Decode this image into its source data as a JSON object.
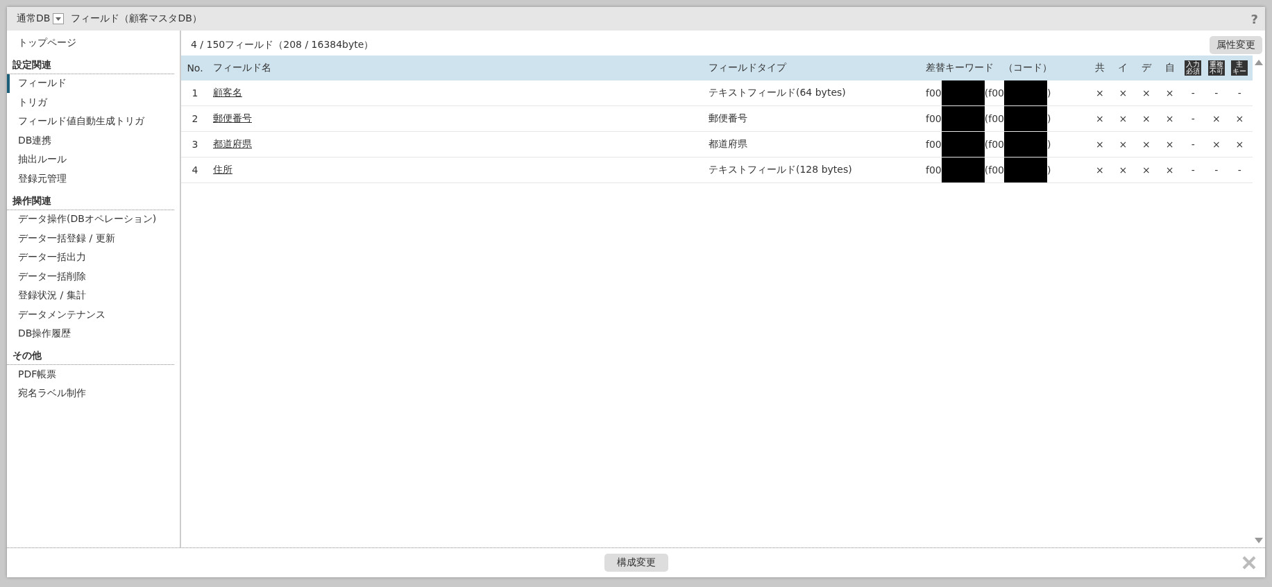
{
  "header": {
    "db_menu": "通常DB",
    "title": "フィールド（顧客マスタDB）",
    "help": "?"
  },
  "sidebar": {
    "top": {
      "label": "トップページ",
      "selected": false
    },
    "sections": [
      {
        "title": "設定関連",
        "items": [
          {
            "label": "フィールド",
            "selected": true
          },
          {
            "label": "トリガ",
            "selected": false
          },
          {
            "label": "フィールド値自動生成トリガ",
            "selected": false
          },
          {
            "label": "DB連携",
            "selected": false
          },
          {
            "label": "抽出ルール",
            "selected": false
          },
          {
            "label": "登録元管理",
            "selected": false
          }
        ]
      },
      {
        "title": "操作関連",
        "items": [
          {
            "label": "データ操作(DBオペレーション)",
            "selected": false
          },
          {
            "label": "データ一括登録 / 更新",
            "selected": false
          },
          {
            "label": "データ一括出力",
            "selected": false
          },
          {
            "label": "データ一括削除",
            "selected": false
          },
          {
            "label": "登録状況 / 集計",
            "selected": false
          },
          {
            "label": "データメンテナンス",
            "selected": false
          },
          {
            "label": "DB操作履歴",
            "selected": false
          }
        ]
      },
      {
        "title": "その他",
        "items": [
          {
            "label": "PDF帳票",
            "selected": false
          },
          {
            "label": "宛名ラベル制作",
            "selected": false
          }
        ]
      }
    ]
  },
  "summary": "4 / 150フィールド（208 / 16384byte）",
  "attr_button": "属性変更",
  "table": {
    "columns": [
      "No.",
      "フィールド名",
      "フィールドタイプ",
      "差替キーワード　（コード）"
    ],
    "flag_columns": [
      {
        "kind": "text",
        "lines": [
          "共"
        ]
      },
      {
        "kind": "text",
        "lines": [
          "イ"
        ]
      },
      {
        "kind": "text",
        "lines": [
          "デ"
        ]
      },
      {
        "kind": "text",
        "lines": [
          "自"
        ]
      },
      {
        "kind": "badge",
        "lines": [
          "入力",
          "必須"
        ]
      },
      {
        "kind": "badge",
        "lines": [
          "重複",
          "不可"
        ]
      },
      {
        "kind": "badge",
        "lines": [
          "主",
          "キー"
        ]
      }
    ],
    "rows": [
      {
        "no": "1",
        "name": "顧客名",
        "type": "テキストフィールド(64 bytes)",
        "keyword": "f00",
        "code_open": "(f00",
        "code_close": ")",
        "redacted": true,
        "flags": [
          "×",
          "×",
          "×",
          "×",
          "-",
          "-",
          "-"
        ]
      },
      {
        "no": "2",
        "name": "郵便番号",
        "type": "郵便番号",
        "keyword": "f00",
        "code_open": "(f00",
        "code_close": ")",
        "redacted": true,
        "flags": [
          "×",
          "×",
          "×",
          "×",
          "-",
          "×",
          "×"
        ]
      },
      {
        "no": "3",
        "name": "都道府県",
        "type": "都道府県",
        "keyword": "f00",
        "code_open": "(f00",
        "code_close": ")",
        "redacted": true,
        "flags": [
          "×",
          "×",
          "×",
          "×",
          "-",
          "×",
          "×"
        ]
      },
      {
        "no": "4",
        "name": "住所",
        "type": "テキストフィールド(128 bytes)",
        "keyword": "f00",
        "code_open": "(f00",
        "code_close": ")",
        "redacted": true,
        "flags": [
          "×",
          "×",
          "×",
          "×",
          "-",
          "-",
          "-"
        ]
      }
    ]
  },
  "footer_button": "構成変更"
}
